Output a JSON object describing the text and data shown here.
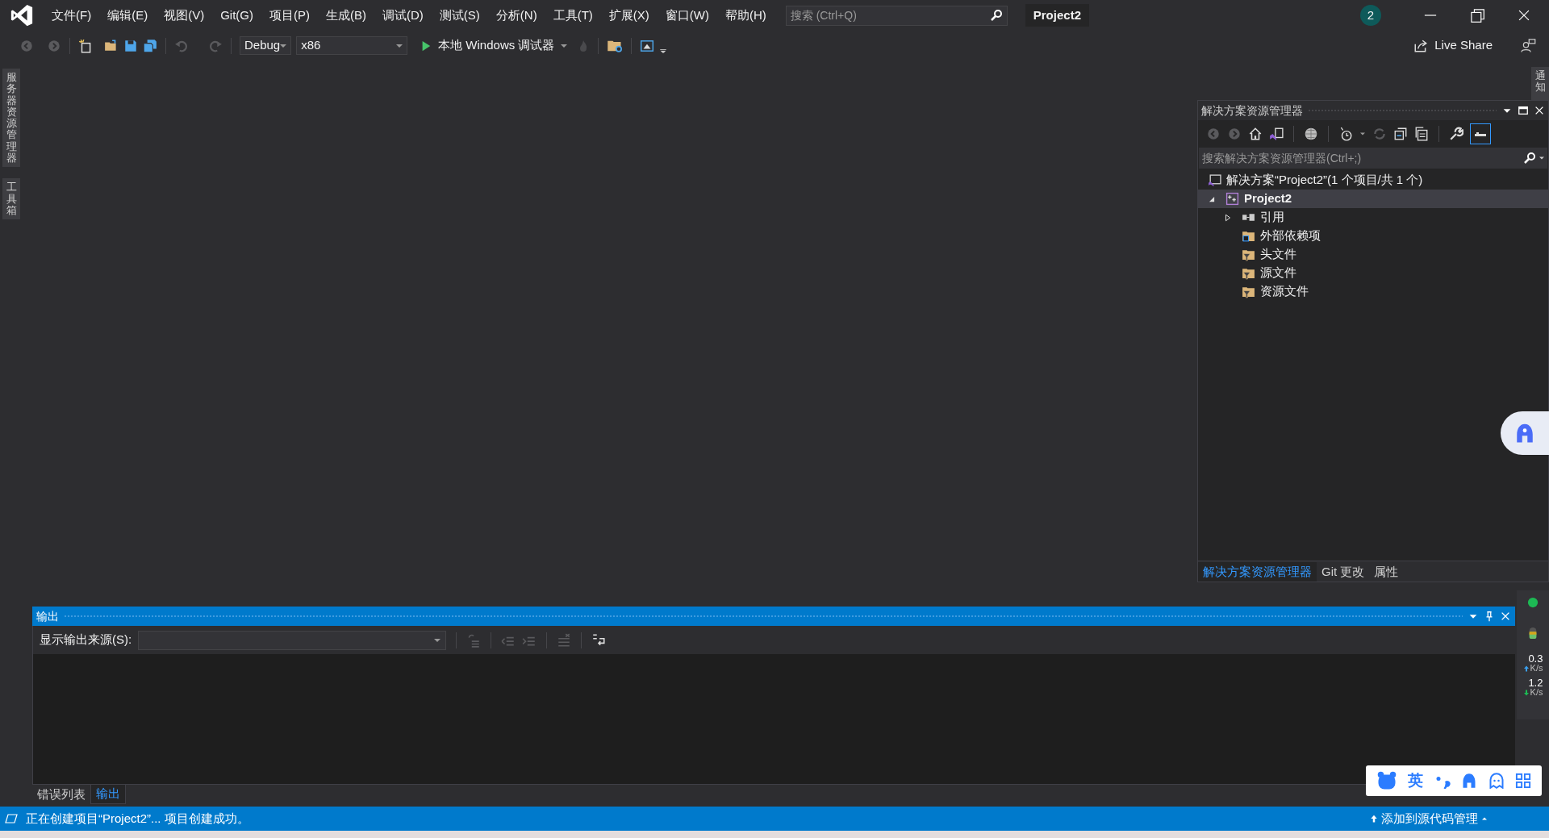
{
  "title_bar": {
    "menu": [
      "文件(F)",
      "编辑(E)",
      "视图(V)",
      "Git(G)",
      "项目(P)",
      "生成(B)",
      "调试(D)",
      "测试(S)",
      "分析(N)",
      "工具(T)",
      "扩展(X)",
      "窗口(W)",
      "帮助(H)"
    ],
    "search": {
      "placeholder": "搜索 (Ctrl+Q)"
    },
    "project": "Project2",
    "notification_count": "2"
  },
  "toolbar": {
    "configuration": "Debug",
    "platform": "x86",
    "run": "本地 Windows 调试器",
    "live_share": "Live Share"
  },
  "left_tabs": [
    "服务器资源管理器",
    "工具箱"
  ],
  "right_tabs": [
    "通知"
  ],
  "solution_explorer": {
    "title": "解决方案资源管理器",
    "search": {
      "placeholder": "搜索解决方案资源管理器(Ctrl+;)"
    },
    "tree": [
      {
        "label": "解决方案“Project2”(1 个项目/共 1 个)",
        "kind": "solution",
        "selected": false,
        "children": [
          {
            "label": "Project2",
            "kind": "project",
            "expanded": true,
            "selected": true,
            "children": [
              {
                "label": "引用",
                "kind": "references",
                "expanded": false,
                "selected": false
              },
              {
                "label": "外部依赖项",
                "kind": "dependencies",
                "selected": false
              },
              {
                "label": "头文件",
                "kind": "filter",
                "selected": false
              },
              {
                "label": "源文件",
                "kind": "filter",
                "selected": false
              },
              {
                "label": "资源文件",
                "kind": "filter",
                "selected": false
              }
            ]
          }
        ]
      }
    ],
    "tabs": [
      {
        "label": "解决方案资源管理器",
        "selected": true
      },
      {
        "label": "Git 更改",
        "selected": false
      },
      {
        "label": "属性",
        "selected": false
      }
    ]
  },
  "output": {
    "title": "输出",
    "source_label": "显示输出来源(S):",
    "tabs": [
      {
        "label": "错误列表",
        "selected": false
      },
      {
        "label": "输出",
        "selected": true
      }
    ]
  },
  "status_bar": {
    "message": "正在创建项目“Project2”... 项目创建成功。",
    "source_control": "添加到源代码管理"
  },
  "network": {
    "upload": {
      "value": "0.3",
      "unit": "K/s"
    },
    "download": {
      "value": "1.2",
      "unit": "K/s"
    }
  },
  "ime": {
    "mode": "英"
  }
}
